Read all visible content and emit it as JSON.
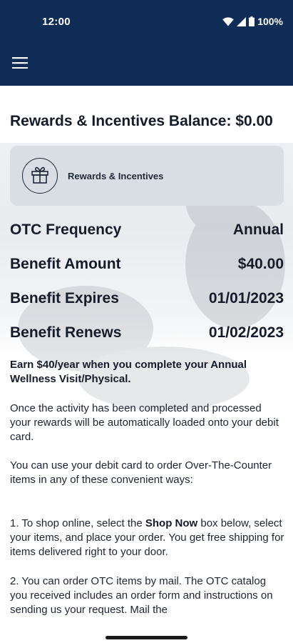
{
  "status_bar": {
    "time": "12:00",
    "battery": "100%",
    "icons": [
      "wifi-icon",
      "signal-icon",
      "battery-icon"
    ]
  },
  "app_bar": {
    "menu_icon": "hamburger-menu-icon"
  },
  "balance": {
    "title": "Rewards & Incentives Balance: $0.00"
  },
  "rewards_card": {
    "icon": "gift-icon",
    "label": "Rewards & Incentives"
  },
  "benefit_rows": [
    {
      "label": "OTC Frequency",
      "value": "Annual"
    },
    {
      "label": "Benefit Amount",
      "value": "$40.00"
    },
    {
      "label": "Benefit Expires",
      "value": "01/01/2023"
    },
    {
      "label": "Benefit Renews",
      "value": "01/02/2023"
    }
  ],
  "paragraphs": {
    "earn": "Earn $40/year when you complete your Annual Wellness Visit/Physical.",
    "activity": "Once the activity has been completed and processed your rewards will be automatically loaded onto your debit card.",
    "use_card": "You can use your debit card to order Over-The-Counter items in any of these convenient ways:",
    "step1_prefix": "1.  To shop online, select the ",
    "step1_bold": "Shop Now",
    "step1_suffix": " box below, select your items, and place your order. You get free shipping for items delivered right to your door.",
    "step2": "2.  You can order OTC items by mail. The OTC catalog you received includes an order form and instructions on sending us your request. Mail the"
  },
  "colors": {
    "header": "#0f2d57",
    "card": "#d9dee5",
    "text": "#141c2b"
  }
}
